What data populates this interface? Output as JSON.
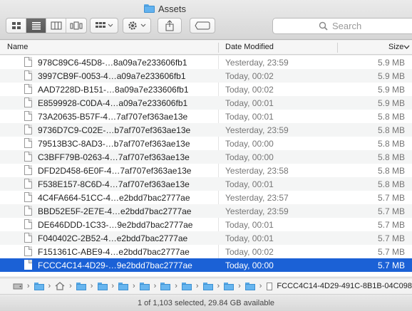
{
  "window": {
    "title": "Assets"
  },
  "toolbar": {
    "view_modes": [
      "icon-view",
      "list-view",
      "column-view",
      "cover-flow-view"
    ],
    "active_view": "list-view",
    "search_placeholder": "Search"
  },
  "columns": {
    "name": "Name",
    "date": "Date Modified",
    "size": "Size"
  },
  "files": [
    {
      "name": "978C89C6-45D8-…8a09a7e233606fb1",
      "date": "Yesterday, 23:59",
      "size": "5.9 MB"
    },
    {
      "name": "3997CB9F-0053-4…a09a7e233606fb1",
      "date": "Today, 00:02",
      "size": "5.9 MB"
    },
    {
      "name": "AAD7228D-B151-…8a09a7e233606fb1",
      "date": "Today, 00:02",
      "size": "5.9 MB"
    },
    {
      "name": "E8599928-C0DA-4…a09a7e233606fb1",
      "date": "Today, 00:01",
      "size": "5.9 MB"
    },
    {
      "name": "73A20635-B57F-4…7af707ef363ae13e",
      "date": "Today, 00:01",
      "size": "5.8 MB"
    },
    {
      "name": "9736D7C9-C02E-…b7af707ef363ae13e",
      "date": "Yesterday, 23:59",
      "size": "5.8 MB"
    },
    {
      "name": "79513B3C-8AD3-…b7af707ef363ae13e",
      "date": "Today, 00:00",
      "size": "5.8 MB"
    },
    {
      "name": "C3BFF79B-0263-4…7af707ef363ae13e",
      "date": "Today, 00:00",
      "size": "5.8 MB"
    },
    {
      "name": "DFD2D458-6E0F-4…7af707ef363ae13e",
      "date": "Yesterday, 23:58",
      "size": "5.8 MB"
    },
    {
      "name": "F538E157-8C6D-4…7af707ef363ae13e",
      "date": "Today, 00:01",
      "size": "5.8 MB"
    },
    {
      "name": "4C4FA664-51CC-4…e2bdd7bac2777ae",
      "date": "Yesterday, 23:57",
      "size": "5.7 MB"
    },
    {
      "name": "BBD52E5F-2E7E-4…e2bdd7bac2777ae",
      "date": "Yesterday, 23:59",
      "size": "5.7 MB"
    },
    {
      "name": "DE646DDD-1C33-…9e2bdd7bac2777ae",
      "date": "Today, 00:01",
      "size": "5.7 MB"
    },
    {
      "name": "F040402C-2B52-4…e2bdd7bac2777ae",
      "date": "Today, 00:01",
      "size": "5.7 MB"
    },
    {
      "name": "F151361C-ABE9-4…e2bdd7bac2777ae",
      "date": "Today, 00:02",
      "size": "5.7 MB"
    },
    {
      "name": "FCCC4C14-4D29-…9e2bdd7bac2777ae",
      "date": "Today, 00:00",
      "size": "5.7 MB",
      "selected": true
    }
  ],
  "pathbar": {
    "last_item": "FCCC4C14-4D29-491C-8B1B-04C098"
  },
  "status": {
    "text": "1 of 1,103 selected, 29.84 GB available"
  },
  "colors": {
    "selection": "#1b61d6",
    "folder": "#62b2ef"
  }
}
